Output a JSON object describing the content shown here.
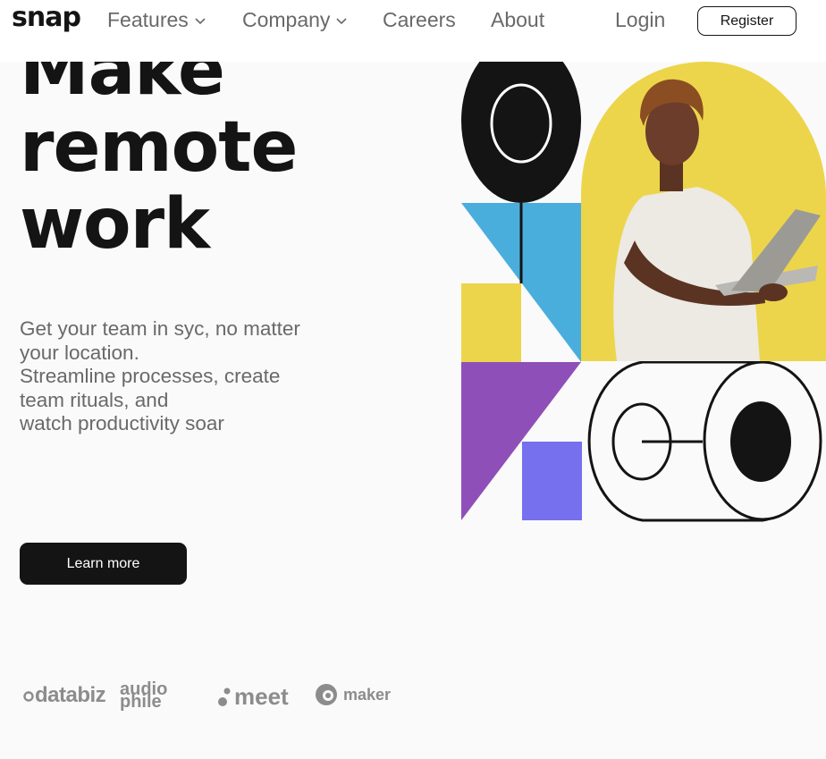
{
  "header": {
    "logo": "snap",
    "nav": [
      {
        "label": "Features",
        "has_dropdown": true
      },
      {
        "label": "Company",
        "has_dropdown": true
      },
      {
        "label": "Careers",
        "has_dropdown": false
      },
      {
        "label": "About",
        "has_dropdown": false
      }
    ],
    "login_label": "Login",
    "register_label": "Register"
  },
  "hero": {
    "title_lines": [
      "Make",
      "remote",
      "work"
    ],
    "description_lines": [
      "Get your team in syc, no matter",
      "your location.",
      "Streamline processes, create",
      "team rituals, and",
      "watch productivity soar"
    ],
    "cta_label": "Learn more"
  },
  "clients": {
    "databiz": "databiz",
    "audiophile_top": "audio",
    "audiophile_bottom": "phile",
    "meet": "meet",
    "maker": "maker"
  },
  "colors": {
    "text_dark": "#141414",
    "text_gray": "#696969",
    "logo_gray": "#8c8c8c",
    "yellow": "#ecd54b",
    "blue": "#4aaedc",
    "purple": "#8f4fb8",
    "violet": "#7670ee",
    "background": "#fafafa"
  }
}
